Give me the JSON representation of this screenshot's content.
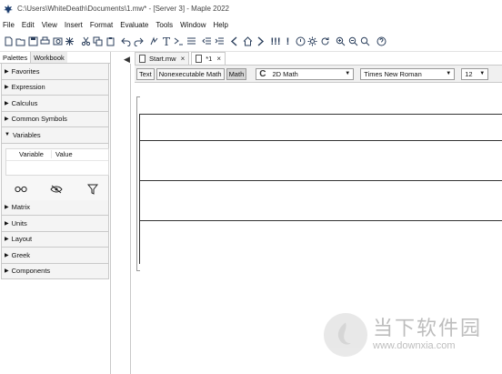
{
  "window": {
    "title": "C:\\Users\\WhiteDeath\\Documents\\1.mw* - [Server 3] - Maple 2022"
  },
  "menubar": {
    "items": [
      "File",
      "Edit",
      "View",
      "Insert",
      "Format",
      "Evaluate",
      "Tools",
      "Window",
      "Help"
    ]
  },
  "toolbar": {
    "icons": [
      "new-icon",
      "open-icon",
      "save-icon",
      "print-icon",
      "print-preview-icon",
      "debug-icon",
      "cut-icon",
      "copy-icon",
      "paste-icon",
      "undo-icon",
      "redo-icon",
      "insert-math-icon",
      "insert-text-icon",
      "execution-group-icon",
      "paragraph-icon",
      "outdent-icon",
      "indent-icon",
      "back-icon",
      "home-icon",
      "forward-icon",
      "execute-all-icon",
      "stop-icon",
      "info-icon",
      "settings-icon",
      "restart-icon",
      "zoom-in-icon",
      "zoom-out-icon",
      "zoom-fit-icon",
      "help-icon"
    ]
  },
  "palette_pane": {
    "tabs": [
      "Palettes",
      "Workbook"
    ],
    "palettes_top": [
      "Favorites",
      "Expression",
      "Calculus",
      "Common Symbols"
    ],
    "variables": {
      "label": "Variables",
      "columns": [
        "Variable",
        "Value"
      ]
    },
    "palettes_bottom": [
      "Matrix",
      "Units",
      "Layout",
      "Greek",
      "Components"
    ]
  },
  "document": {
    "tabs": [
      {
        "label": "Start.mw",
        "close": "×"
      },
      {
        "label": "*1",
        "close": "×"
      }
    ]
  },
  "context_bar": {
    "modes": [
      "Text",
      "Nonexecutable Math",
      "Math"
    ],
    "math_mode_label": "2D Math",
    "font_family": "Times New Roman",
    "font_size": "12"
  },
  "watermark": {
    "title": "当下软件园",
    "url": "www.downxia.com"
  },
  "colors": {
    "toolbar_icon": "#2b3f5c",
    "pane_border": "#c9c9c9",
    "context_bar_bg": "#f0f0f0"
  }
}
